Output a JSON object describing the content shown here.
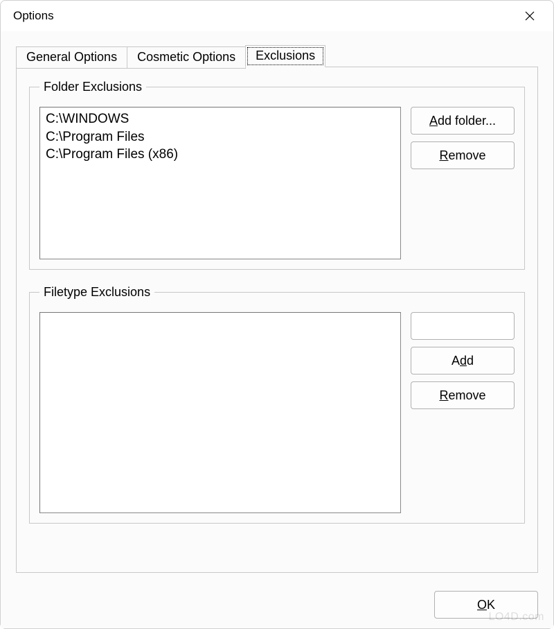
{
  "window": {
    "title": "Options"
  },
  "tabs": {
    "general": "General Options",
    "cosmetic": "Cosmetic Options",
    "exclusions": "Exclusions"
  },
  "folder_exclusions": {
    "legend": "Folder Exclusions",
    "items": [
      "C:\\WINDOWS",
      "C:\\Program Files",
      "C:\\Program Files (x86)"
    ],
    "add_button": "Add folder...",
    "remove_button": "Remove"
  },
  "filetype_exclusions": {
    "legend": "Filetype Exclusions",
    "items": [],
    "input_value": "",
    "add_button": "Add",
    "remove_button": "Remove"
  },
  "footer": {
    "ok_button": "OK"
  },
  "watermark": "LO4D.com"
}
